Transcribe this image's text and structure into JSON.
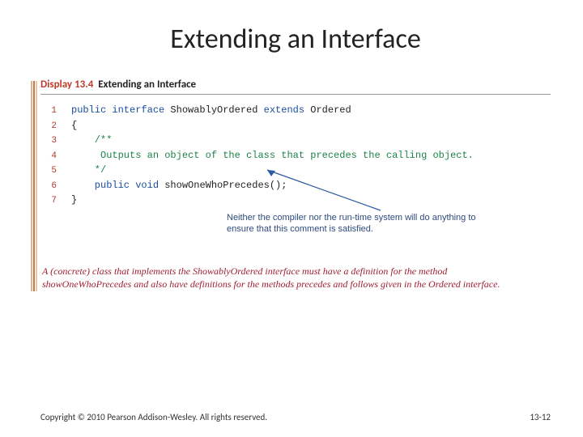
{
  "title": "Extending an Interface",
  "display": {
    "label": "Display",
    "number": "13.4",
    "caption": "Extending an Interface"
  },
  "code": {
    "lines": [
      {
        "n": "1",
        "kw": "public interface",
        "rest": " ShowablyOrdered ",
        "kw2": "extends",
        "rest2": " Ordered"
      },
      {
        "n": "2",
        "plain": "{"
      },
      {
        "n": "3",
        "cmt": "    /**"
      },
      {
        "n": "4",
        "cmt": "     Outputs an object of the class that precedes the calling object."
      },
      {
        "n": "5",
        "cmt": "    */"
      },
      {
        "n": "6",
        "kw": "    public void",
        "rest": " showOneWhoPrecedes();"
      },
      {
        "n": "7",
        "plain": "}"
      }
    ]
  },
  "annotation": "Neither the compiler nor the run-time system will do anything to ensure that this comment is satisfied.",
  "note": "A (concrete) class that implements the ShowablyOrdered interface must have a definition for the method showOneWhoPrecedes and also have definitions for the methods precedes and follows given in the Ordered interface.",
  "footer": {
    "copyright": "Copyright © 2010 Pearson Addison-Wesley. All rights reserved.",
    "page": "13-12"
  }
}
